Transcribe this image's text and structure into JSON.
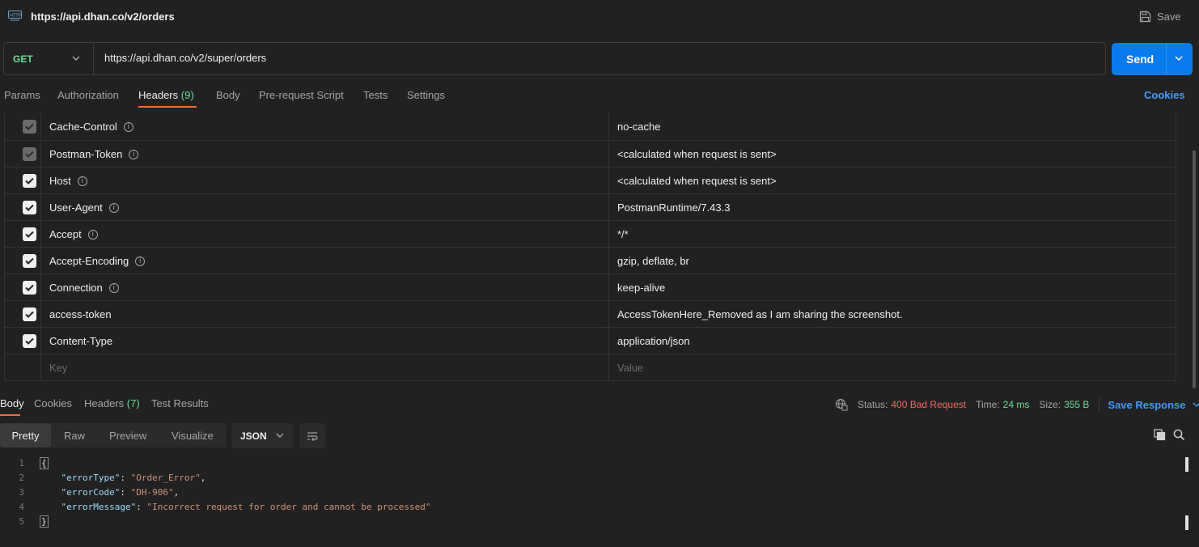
{
  "window": {
    "title": "https://api.dhan.co/v2/orders",
    "save_label": "Save"
  },
  "request": {
    "method": "GET",
    "url": "https://api.dhan.co/v2/super/orders",
    "send_label": "Send"
  },
  "req_tabs": {
    "params": "Params",
    "authorization": "Authorization",
    "headers": "Headers",
    "headers_count": "(9)",
    "body": "Body",
    "prerequest": "Pre-request Script",
    "tests": "Tests",
    "settings": "Settings",
    "cookies": "Cookies"
  },
  "headers": [
    {
      "key": "Cache-Control",
      "value": "no-cache",
      "checked": true,
      "auto": true,
      "info": true
    },
    {
      "key": "Postman-Token",
      "value": "<calculated when request is sent>",
      "checked": true,
      "auto": true,
      "info": true
    },
    {
      "key": "Host",
      "value": "<calculated when request is sent>",
      "checked": true,
      "auto": false,
      "info": true
    },
    {
      "key": "User-Agent",
      "value": "PostmanRuntime/7.43.3",
      "checked": true,
      "auto": false,
      "info": true
    },
    {
      "key": "Accept",
      "value": "*/*",
      "checked": true,
      "auto": false,
      "info": true
    },
    {
      "key": "Accept-Encoding",
      "value": "gzip, deflate, br",
      "checked": true,
      "auto": false,
      "info": true
    },
    {
      "key": "Connection",
      "value": "keep-alive",
      "checked": true,
      "auto": false,
      "info": true
    },
    {
      "key": "access-token",
      "value": "AccessTokenHere_Removed as I am sharing the screenshot.",
      "checked": true,
      "auto": false,
      "info": false
    },
    {
      "key": "Content-Type",
      "value": "application/json",
      "checked": true,
      "auto": false,
      "info": false
    }
  ],
  "new_header": {
    "key_placeholder": "Key",
    "value_placeholder": "Value"
  },
  "res_tabs": {
    "body": "Body",
    "cookies": "Cookies",
    "headers": "Headers",
    "headers_count": "(7)",
    "test_results": "Test Results"
  },
  "response_status": {
    "status_label": "Status:",
    "status_value": "400 Bad Request",
    "time_label": "Time:",
    "time_value": "24 ms",
    "size_label": "Size:",
    "size_value": "355 B",
    "save_response": "Save Response"
  },
  "view_modes": {
    "pretty": "Pretty",
    "raw": "Raw",
    "preview": "Preview",
    "visualize": "Visualize",
    "format": "JSON"
  },
  "response_body": {
    "line_numbers": [
      "1",
      "2",
      "3",
      "4",
      "5"
    ],
    "open_brace": "{",
    "close_brace": "}",
    "k1": "\"errorType\"",
    "v1": "\"Order_Error\"",
    "k2": "\"errorCode\"",
    "v2": "\"DH-906\"",
    "k3": "\"errorMessage\"",
    "v3": "\"Incorrect request for order and cannot be processed\""
  },
  "colors": {
    "accent": "#ff6c37",
    "send_button": "#097bed",
    "method_get": "#6bdd9a",
    "status_error": "#f26b5b",
    "link": "#3f9bff"
  }
}
